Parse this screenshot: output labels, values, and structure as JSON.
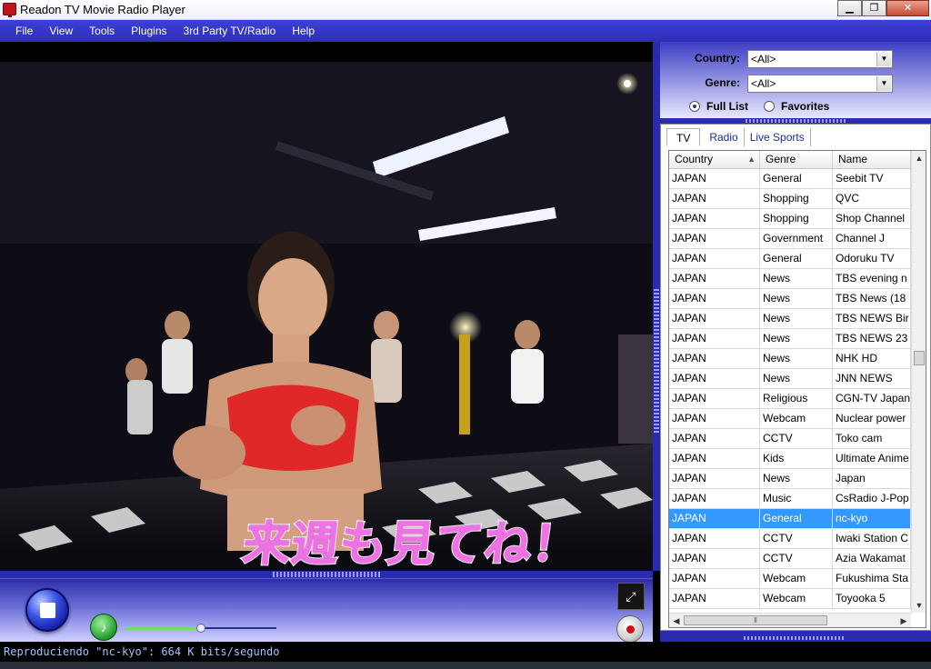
{
  "window": {
    "title": "Readon TV Movie Radio Player",
    "controls": {
      "minimize": "▁",
      "maximize": "❐",
      "close": "✕"
    }
  },
  "menu": [
    "File",
    "View",
    "Tools",
    "Plugins",
    "3rd Party TV/Radio",
    "Help"
  ],
  "video": {
    "caption": "来週も見てね！"
  },
  "player": {
    "volume_level": 0.5,
    "icons": {
      "stop": "stop-icon",
      "volume": "speaker-icon",
      "fullscreen": "fullscreen-icon",
      "record": "record-icon"
    }
  },
  "filters": {
    "country_label": "Country:",
    "country_value": "<All>",
    "genre_label": "Genre:",
    "genre_value": "<All>",
    "full_list_label": "Full List",
    "favorites_label": "Favorites",
    "selected_mode": "Full List"
  },
  "tabs": [
    {
      "label": "TV",
      "active": true
    },
    {
      "label": "Radio",
      "active": false
    },
    {
      "label": "Live Sports",
      "active": false
    }
  ],
  "table": {
    "columns": [
      "Country",
      "Genre",
      "Name"
    ],
    "rows": [
      [
        "JAPAN",
        "General",
        "Seebit TV"
      ],
      [
        "JAPAN",
        "Shopping",
        "QVC"
      ],
      [
        "JAPAN",
        "Shopping",
        "Shop Channel"
      ],
      [
        "JAPAN",
        "Government",
        "Channel J"
      ],
      [
        "JAPAN",
        "General",
        "Odoruku TV"
      ],
      [
        "JAPAN",
        "News",
        "TBS evening n"
      ],
      [
        "JAPAN",
        "News",
        "TBS News (18"
      ],
      [
        "JAPAN",
        "News",
        "TBS NEWS Bir"
      ],
      [
        "JAPAN",
        "News",
        "TBS NEWS 23"
      ],
      [
        "JAPAN",
        "News",
        "NHK HD"
      ],
      [
        "JAPAN",
        "News",
        "JNN NEWS"
      ],
      [
        "JAPAN",
        "Religious",
        "CGN-TV Japan"
      ],
      [
        "JAPAN",
        "Webcam",
        "Nuclear power"
      ],
      [
        "JAPAN",
        "CCTV",
        "Toko cam"
      ],
      [
        "JAPAN",
        "Kids",
        "Ultimate Anime"
      ],
      [
        "JAPAN",
        "News",
        "Japan"
      ],
      [
        "JAPAN",
        "Music",
        "CsRadio J-Pop"
      ],
      [
        "JAPAN",
        "General",
        "nc-kyo"
      ],
      [
        "JAPAN",
        "CCTV",
        "Iwaki Station C"
      ],
      [
        "JAPAN",
        "CCTV",
        "Azia Wakamat"
      ],
      [
        "JAPAN",
        "Webcam",
        "Fukushima Sta"
      ],
      [
        "JAPAN",
        "Webcam",
        "Toyooka 5"
      ]
    ],
    "selected_index": 17,
    "hscroll_grip": "⦀"
  },
  "status": {
    "text": "Reproduciendo \"nc-kyo\": 664 K bits/segundo"
  },
  "colors": {
    "accent": "#2d2eb8",
    "selection": "#3399ff",
    "caption": "#f070e6"
  }
}
